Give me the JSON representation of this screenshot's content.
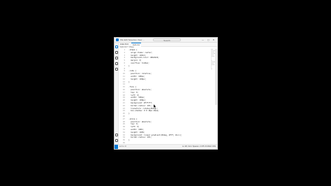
{
  "titlebar": {
    "menu": "File Edit Selection View ...",
    "search": "Search",
    "controls": "— ▢ ✕"
  },
  "tabs": [
    {
      "label": "index.html"
    },
    {
      "label": "style.css"
    }
  ],
  "breadcrumb": "style.css > .shape",
  "code_lines": [
    "  .shape {",
    "    align-items: center;",
    "    height: 100vh;",
    "    background-color: #2b2b2b;",
    "    margin: 0;",
    "    overflow: hidden;",
    "  }",
    "",
    "  .cube {",
    "    position: relative;",
    "    width: 100px;",
    "    height: 100px;",
    "  }",
    "",
    "  .face {",
    "    position: absolute;",
    "    top: 0;",
    "    left: 0;",
    "    width: 100px;",
    "    height: 100px;",
    "    background: #f7f7f7;",
    "    border-radius: 10%;",
    "    transform: rotate(45deg);",
    "    box-shadow: 0 0 10px #aaa;",
    "  }",
    "",
    "  .shine {",
    "    position: absolute;",
    "    top: 0;",
    "    left: 0;",
    "    width: 100%;",
    "    height: 100%;",
    "    background: linear-gradient(45deg, #fff, #ccc);",
    "    border-radius: 10%;",
    "  }",
    "",
    ""
  ],
  "statusbar": {
    "left": "⊗ 0 ⚠ 0",
    "right": "Ln 28, Col 1  Spaces: 2  UTF-8  CRLF  CSS"
  }
}
